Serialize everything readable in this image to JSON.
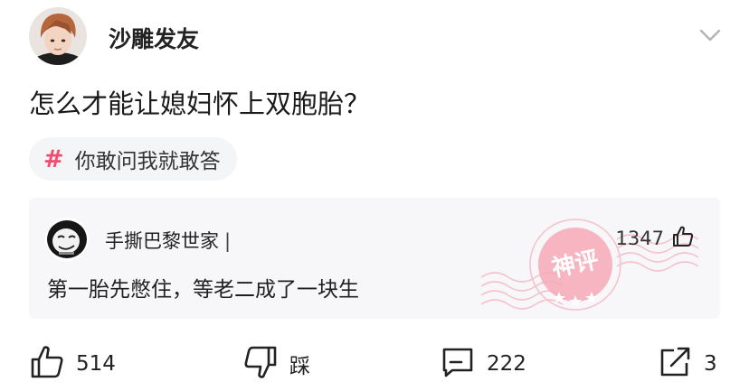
{
  "post": {
    "author": "沙雕发友",
    "title": "怎么才能让媳妇怀上双胞胎？",
    "topic": "你敢问我就敢答",
    "topic_symbol": "#"
  },
  "god_comment": {
    "author": "手撕巴黎世家",
    "separator": "|",
    "likes": "1347",
    "text": "第一胎先憋住，等老二成了一块生",
    "stamp_label": "神评"
  },
  "actions": {
    "like_count": "514",
    "dislike_label": "踩",
    "comment_count": "222",
    "share_count": "3"
  },
  "colors": {
    "accent_pink": "#f04d70",
    "stamp_pink": "#f6a9b6",
    "card_bg": "#f7f7f9",
    "pill_bg": "#f4f5f7"
  },
  "icons": {
    "expand": "chevron-down-icon",
    "topic": "hashtag-icon",
    "like": "thumbs-up-icon",
    "dislike": "thumbs-down-icon",
    "comment": "comment-icon",
    "share": "share-icon"
  }
}
